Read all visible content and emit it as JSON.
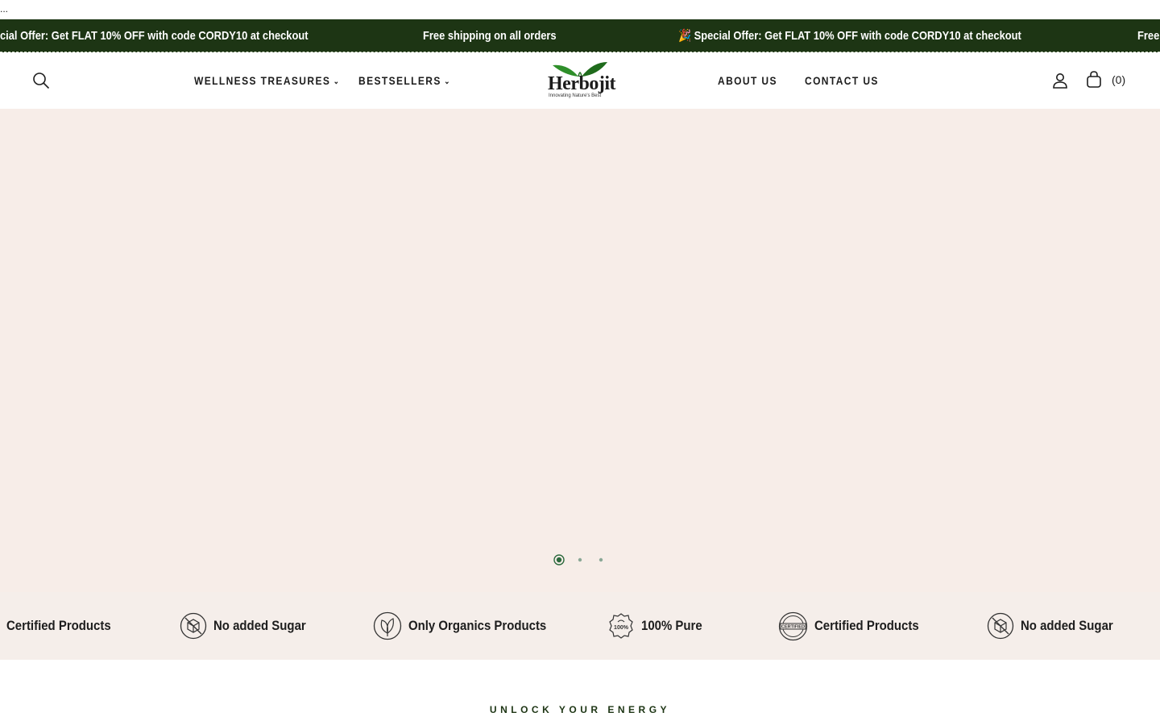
{
  "top_ellipsis": "...",
  "announcement": {
    "items": [
      "cial Offer: Get FLAT 10% OFF with code CORDY10 at checkout",
      "Free shipping on all orders",
      "🎉 Special Offer: Get FLAT 10% OFF with code CORDY10 at checkout",
      "Free"
    ]
  },
  "header": {
    "nav_left": [
      "WELLNESS TREASURES",
      "BESTSELLERS"
    ],
    "nav_right": [
      "ABOUT US",
      "CONTACT US"
    ],
    "logo_text": "Herbojit",
    "logo_tagline": "Innovating  Nature's  Best",
    "cart_count": "(0)"
  },
  "hero": {
    "slide_count": 3,
    "active_slide": 1,
    "background": "#f7ede8"
  },
  "features": [
    {
      "icon": "certified-icon",
      "label": "Certified Products"
    },
    {
      "icon": "no-sugar-icon",
      "label": "No added Sugar"
    },
    {
      "icon": "organic-icon",
      "label": "Only Organics Products"
    },
    {
      "icon": "pure-100-icon",
      "label": "100% Pure"
    },
    {
      "icon": "certified-icon",
      "label": "Certified Products"
    },
    {
      "icon": "no-sugar-icon",
      "label": "No added Sugar"
    }
  ],
  "section": {
    "kicker": "UNLOCK YOUR ENERGY"
  },
  "colors": {
    "brand_green": "#1d3514",
    "hero_bg": "#f7ede8",
    "feature_bg": "#f5eeea"
  }
}
